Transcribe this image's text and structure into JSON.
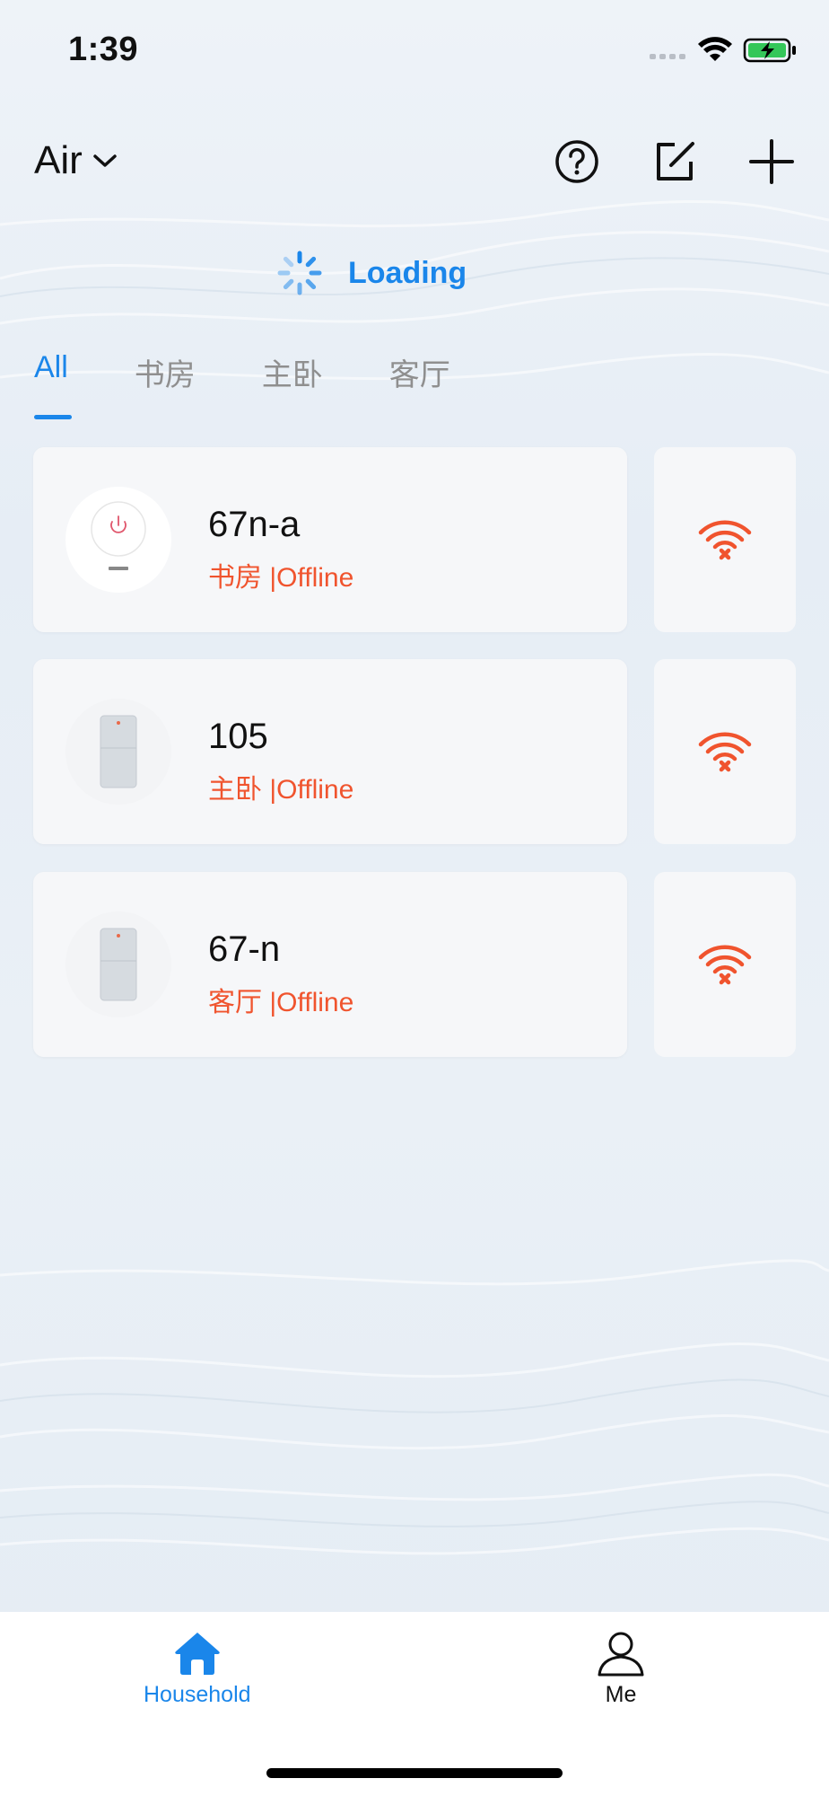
{
  "status_bar": {
    "time": "1:39"
  },
  "header": {
    "home_name": "Air",
    "icons": [
      "help-circle-icon",
      "edit-icon",
      "plus-icon"
    ]
  },
  "loading": {
    "text": "Loading"
  },
  "tabs": [
    {
      "label": "All",
      "active": true
    },
    {
      "label": "书房",
      "active": false
    },
    {
      "label": "主卧",
      "active": false
    },
    {
      "label": "客厅",
      "active": false
    }
  ],
  "devices": [
    {
      "name": "67n-a",
      "room": "书房",
      "status": "|Offline",
      "image": "round-purifier"
    },
    {
      "name": "105",
      "room": "主卧",
      "status": "|Offline",
      "image": "tower-purifier"
    },
    {
      "name": "67-n",
      "room": "客厅",
      "status": "|Offline",
      "image": "tower-purifier"
    }
  ],
  "tabbar": {
    "household": "Household",
    "me": "Me"
  },
  "colors": {
    "accent": "#1a86ea",
    "offline": "#f0542e",
    "battery": "#34c759"
  }
}
